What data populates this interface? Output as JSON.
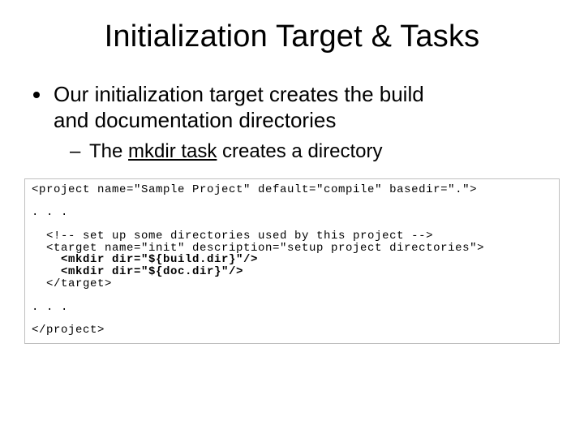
{
  "title": "Initialization Target & Tasks",
  "bullet1_a": "Our initialization target creates the build",
  "bullet1_b": "and documentation directories",
  "sub_a": "The ",
  "sub_link": "mkdir task",
  "sub_b": " creates a directory",
  "code": {
    "l1": "<project name=\"Sample Project\" default=\"compile\" basedir=\".\">",
    "dots1": ". . .",
    "c1": "  <!-- set up some directories used by this project -->",
    "c2": "  <target name=\"init\" description=\"setup project directories\">",
    "c3": "    <mkdir dir=\"${build.dir}\"/>",
    "c4": "    <mkdir dir=\"${doc.dir}\"/>",
    "c5": "  </target>",
    "dots2": ". . .",
    "lend": "</project>"
  }
}
